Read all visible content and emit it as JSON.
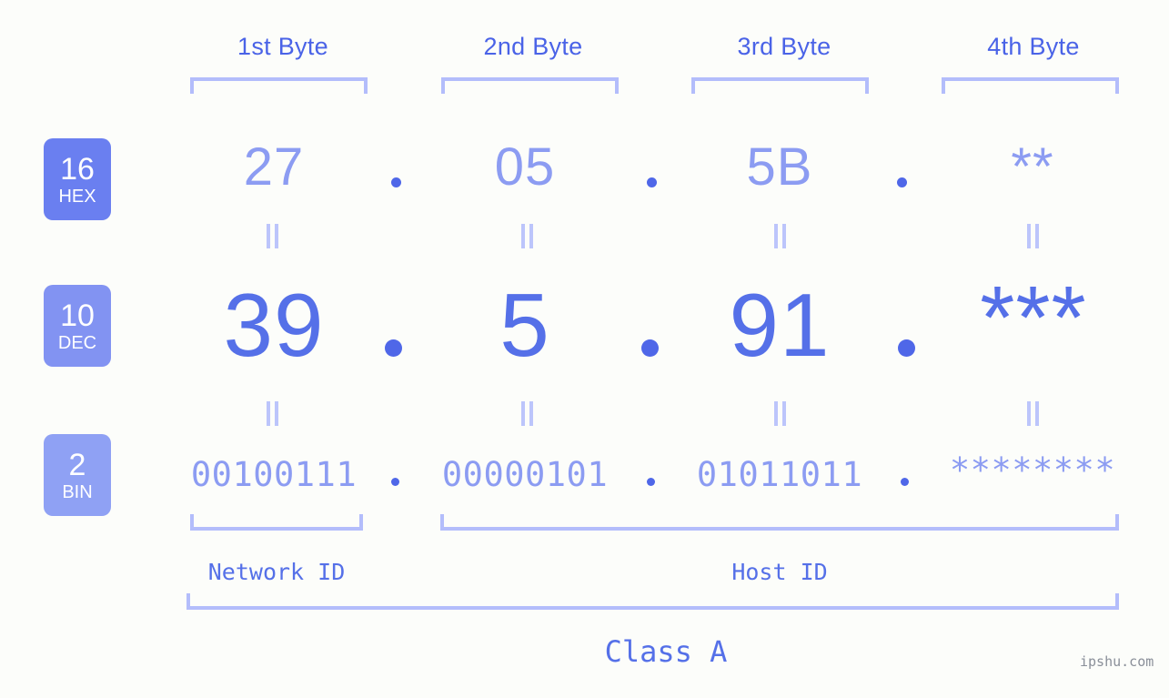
{
  "meta": {
    "background_color": "#fcfdfa",
    "accent_color": "#5570e8",
    "light_accent_color": "#8c9cf2",
    "bracket_color": "#b3bdfb",
    "watermark": "ipshu.com"
  },
  "byte_headers": [
    {
      "label": "1st Byte"
    },
    {
      "label": "2nd Byte"
    },
    {
      "label": "3rd Byte"
    },
    {
      "label": "4th Byte"
    }
  ],
  "radix_badges": [
    {
      "num": "16",
      "name": "HEX",
      "color": "#6a7ff0"
    },
    {
      "num": "10",
      "name": "DEC",
      "color": "#8293f2"
    },
    {
      "num": "2",
      "name": "BIN",
      "color": "#8fa1f4"
    }
  ],
  "rows": {
    "hex": {
      "values": [
        "27",
        "05",
        "5B",
        "**"
      ],
      "separator": "."
    },
    "dec": {
      "values": [
        "39",
        "5",
        "91",
        "***"
      ],
      "separator": "."
    },
    "bin": {
      "values": [
        "00100111",
        "00000101",
        "01011011",
        "********"
      ],
      "separator": "."
    }
  },
  "equals_marks": {
    "symbol": "=",
    "count_per_row": 4
  },
  "id_labels": [
    {
      "label": "Network ID"
    },
    {
      "label": "Host ID"
    }
  ],
  "class_label": {
    "label": "Class A"
  }
}
